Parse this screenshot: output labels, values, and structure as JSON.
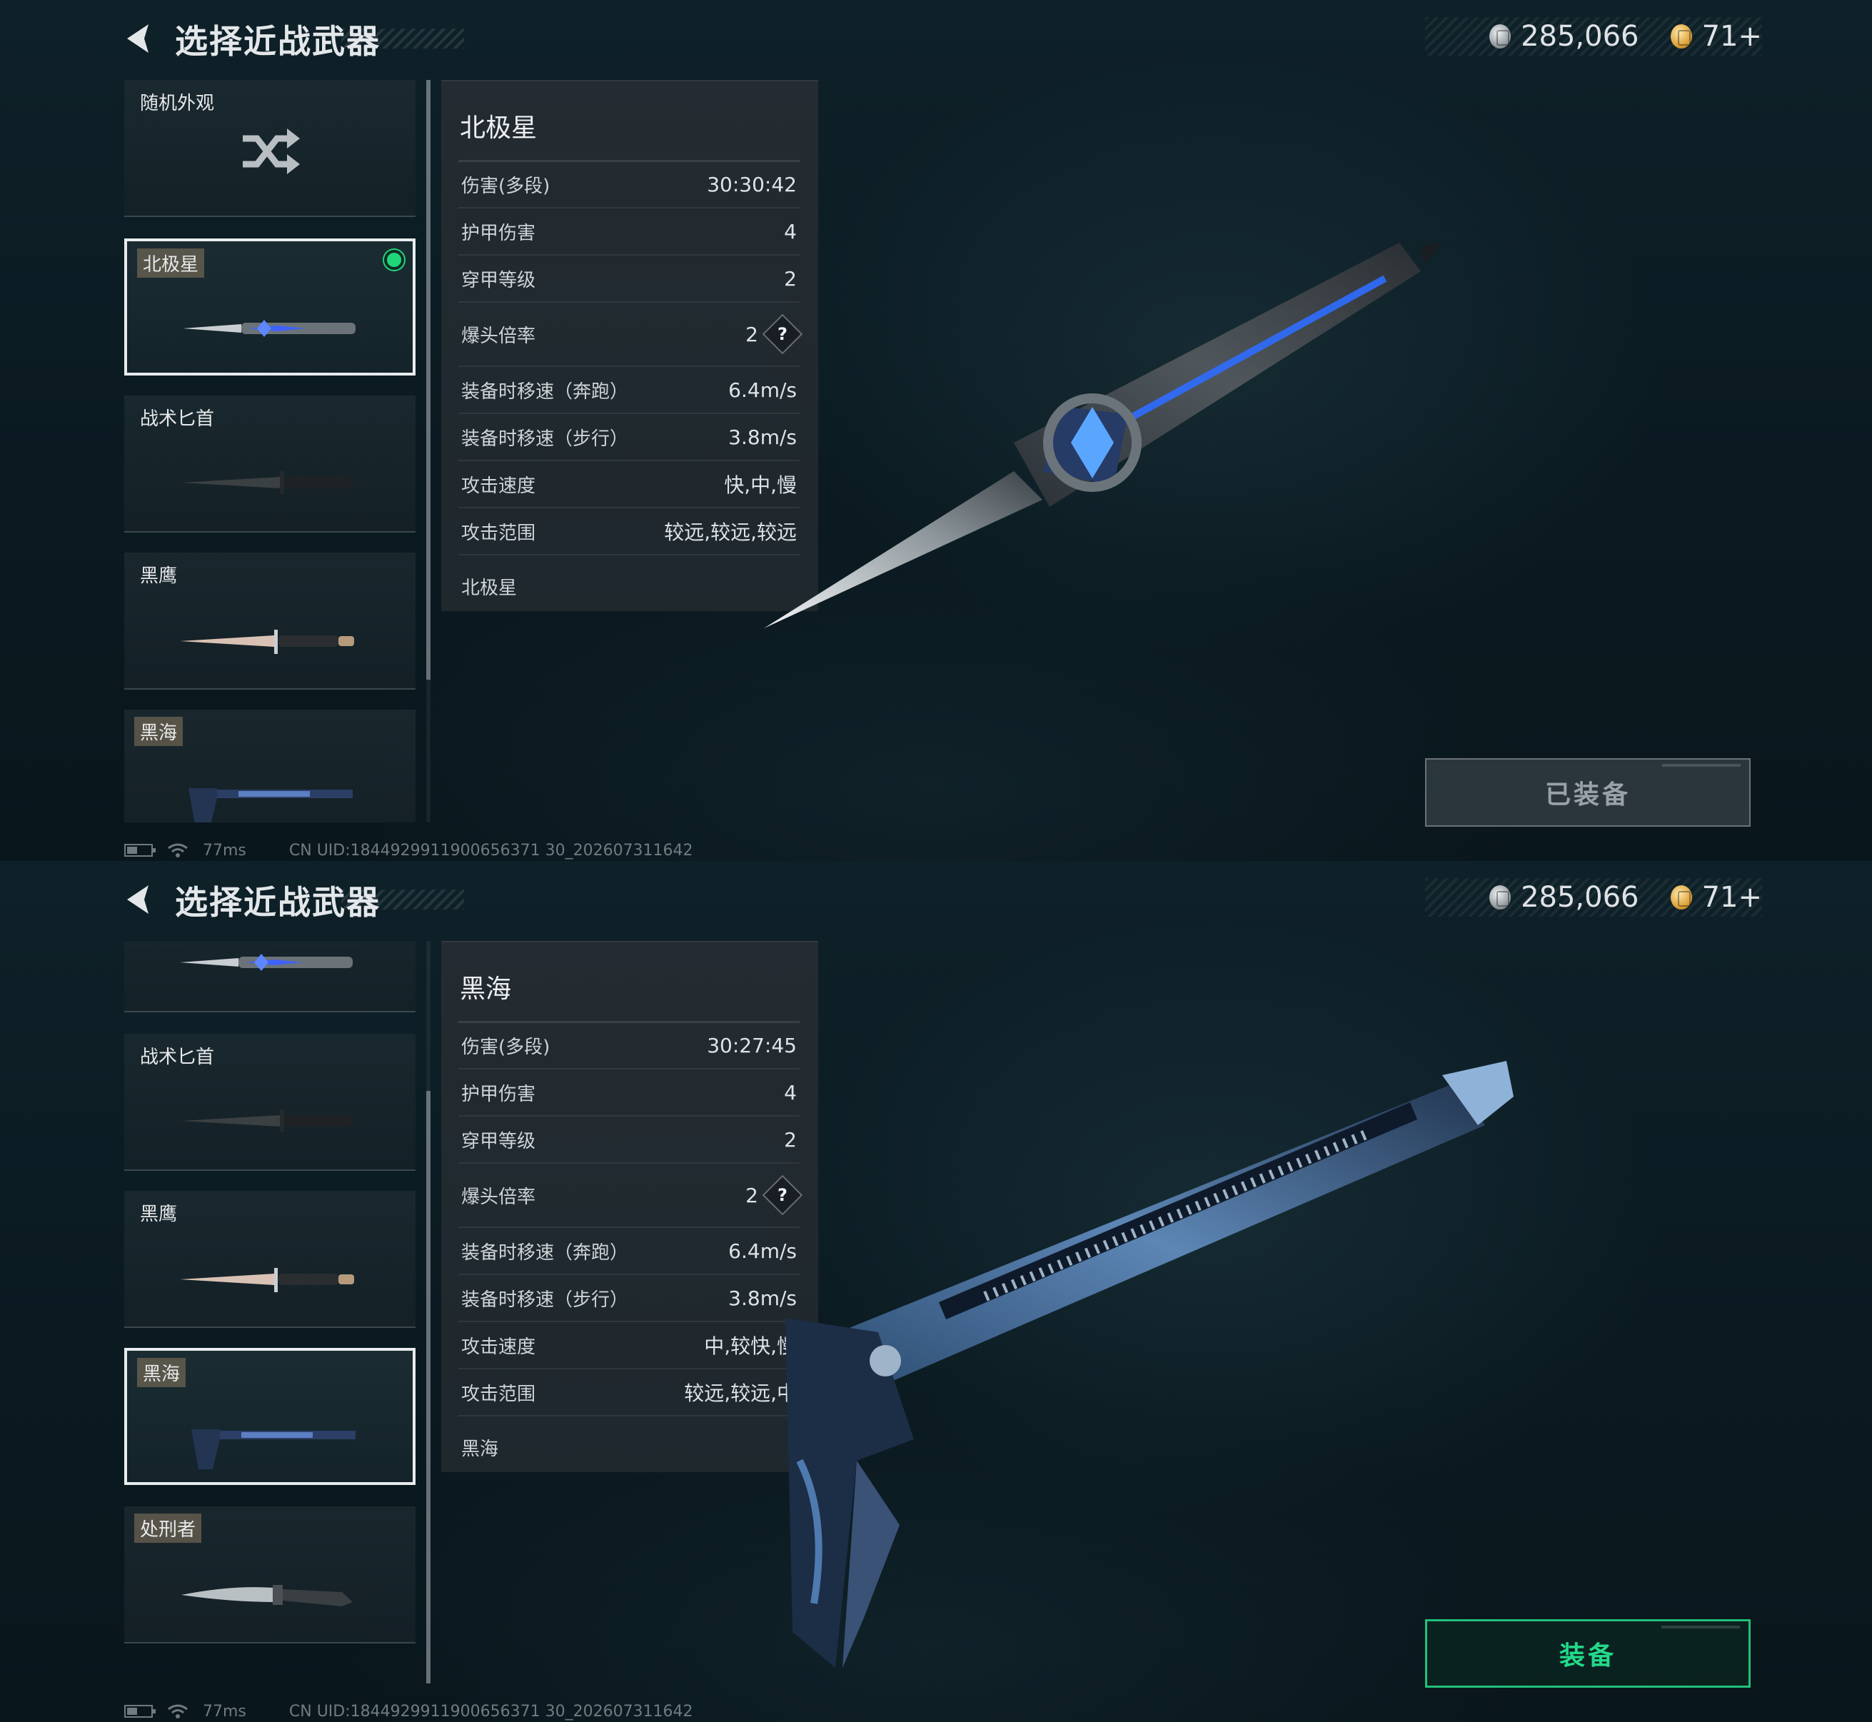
{
  "screens": [
    {
      "header": {
        "title": "选择近战武器",
        "currency_silver": "285,066",
        "currency_gold": "71+"
      },
      "list": {
        "items": [
          {
            "label": "随机外观"
          },
          {
            "label": "北极星"
          },
          {
            "label": "战术匕首"
          },
          {
            "label": "黑鹰"
          },
          {
            "label": "黑海"
          }
        ]
      },
      "stats": {
        "name": "北极星",
        "rows": [
          {
            "key": "伤害(多段)",
            "value": "30:30:42"
          },
          {
            "key": "护甲伤害",
            "value": "4"
          },
          {
            "key": "穿甲等级",
            "value": "2"
          },
          {
            "key": "爆头倍率",
            "value": "2"
          },
          {
            "key": "装备时移速（奔跑）",
            "value": "6.4m/s"
          },
          {
            "key": "装备时移速（步行）",
            "value": "3.8m/s"
          },
          {
            "key": "攻击速度",
            "value": "快,中,慢"
          },
          {
            "key": "攻击范围",
            "value": "较远,较远,较远"
          }
        ],
        "footer": "北极星",
        "help_glyph": "?"
      },
      "equip_button": "已装备",
      "status": {
        "latency": "77ms",
        "uid": "CN UID:1844929911900656371 30_202607311642"
      }
    },
    {
      "header": {
        "title": "选择近战武器",
        "currency_silver": "285,066",
        "currency_gold": "71+"
      },
      "list": {
        "items": [
          {
            "label": ""
          },
          {
            "label": "战术匕首"
          },
          {
            "label": "黑鹰"
          },
          {
            "label": "黑海"
          },
          {
            "label": "处刑者"
          }
        ]
      },
      "stats": {
        "name": "黑海",
        "rows": [
          {
            "key": "伤害(多段)",
            "value": "30:27:45"
          },
          {
            "key": "护甲伤害",
            "value": "4"
          },
          {
            "key": "穿甲等级",
            "value": "2"
          },
          {
            "key": "爆头倍率",
            "value": "2"
          },
          {
            "key": "装备时移速（奔跑）",
            "value": "6.4m/s"
          },
          {
            "key": "装备时移速（步行）",
            "value": "3.8m/s"
          },
          {
            "key": "攻击速度",
            "value": "中,较快,慢"
          },
          {
            "key": "攻击范围",
            "value": "较远,较远,中"
          }
        ],
        "footer": "黑海",
        "help_glyph": "?"
      },
      "equip_button": "装备",
      "status": {
        "latency": "77ms",
        "uid": "CN UID:1844929911900656371 30_202607311642"
      }
    }
  ],
  "colors": {
    "accent_green": "#22c07a",
    "selected_border": "#e8ecee",
    "background": "#0b1b22"
  }
}
